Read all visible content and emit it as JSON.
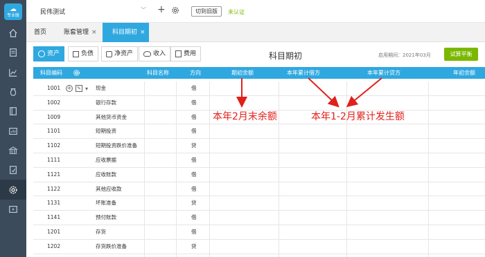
{
  "logo": {
    "line1": "小",
    "line2": "专业版"
  },
  "sidebar": {
    "items": [
      {
        "icon": "home-icon"
      },
      {
        "icon": "voucher-icon"
      },
      {
        "icon": "chart-icon"
      },
      {
        "icon": "money-bag-icon"
      },
      {
        "icon": "ledger-icon"
      },
      {
        "icon": "report-icon"
      },
      {
        "icon": "bank-icon"
      },
      {
        "icon": "tax-icon"
      },
      {
        "icon": "settings-icon",
        "active": true
      },
      {
        "icon": "video-icon"
      }
    ]
  },
  "topbar": {
    "account_name": "民伟测试",
    "caret": "﹀",
    "plus": "+",
    "switch_label": "切到旧版",
    "unverified": "未认证"
  },
  "tabs": [
    {
      "label": "首页"
    },
    {
      "label": "账套管理",
      "close": "×"
    },
    {
      "label": "科目期初",
      "close": "×",
      "active": true
    }
  ],
  "subtabs": [
    {
      "label": "资产",
      "active": true
    },
    {
      "label": "负债"
    },
    {
      "label": "净资产"
    },
    {
      "label": "收入"
    },
    {
      "label": "费用"
    }
  ],
  "page_title": "科目期初",
  "enable_period": "启用期间：2021年03月",
  "balance_button": "试算平衡",
  "columns": {
    "code": "科目编码",
    "name": "科目名称",
    "direction": "方向",
    "opening": "期初余额",
    "debit": "本年累计借方",
    "credit": "本年累计贷方",
    "year_start": "年初余额"
  },
  "rows": [
    {
      "code": "1001",
      "name": "现金",
      "dir": "借",
      "actions": true
    },
    {
      "code": "1002",
      "name": "银行存款",
      "dir": "借"
    },
    {
      "code": "1009",
      "name": "其他货币资金",
      "dir": "借"
    },
    {
      "code": "1101",
      "name": "短期投资",
      "dir": "借"
    },
    {
      "code": "1102",
      "name": "短期投资跌价准备",
      "dir": "贷"
    },
    {
      "code": "1111",
      "name": "应收票据",
      "dir": "借"
    },
    {
      "code": "1121",
      "name": "应收账款",
      "dir": "借"
    },
    {
      "code": "1122",
      "name": "其他应收款",
      "dir": "借"
    },
    {
      "code": "1131",
      "name": "坏账准备",
      "dir": "贷"
    },
    {
      "code": "1141",
      "name": "预付账款",
      "dir": "借"
    },
    {
      "code": "1201",
      "name": "存货",
      "dir": "借"
    },
    {
      "code": "1202",
      "name": "存货跌价准备",
      "dir": "贷"
    }
  ],
  "annotations": {
    "opening_note": "本年2月末余额",
    "accum_note": "本年1-2月累计发生额"
  },
  "colors": {
    "sidebar": "#3b4b5c",
    "accent": "#2fa8e0",
    "green": "#7ab800",
    "annotation": "#e0201a"
  }
}
